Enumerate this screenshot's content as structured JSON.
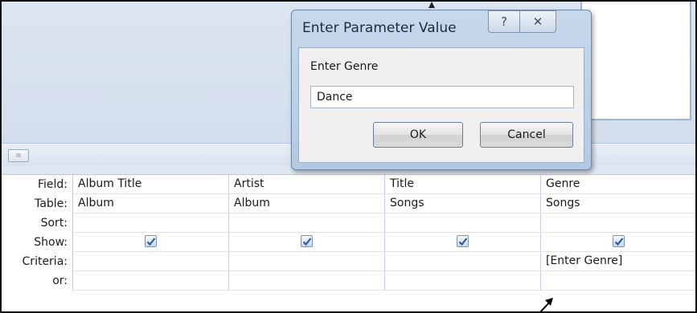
{
  "dialog": {
    "title": "Enter Parameter Value",
    "help_glyph": "?",
    "close_glyph": "✕",
    "prompt": "Enter Genre",
    "input_value": "Dance",
    "ok_label": "OK",
    "cancel_label": "Cancel"
  },
  "scrollbar": {
    "thumb_glyph": "III"
  },
  "grid": {
    "row_labels": [
      "Field:",
      "Table:",
      "Sort:",
      "Show:",
      "Criteria:",
      "or:"
    ],
    "columns": [
      {
        "field": "Album Title",
        "table": "Album",
        "sort": "",
        "show": true,
        "criteria": "",
        "or": ""
      },
      {
        "field": "Artist",
        "table": "Album",
        "sort": "",
        "show": true,
        "criteria": "",
        "or": ""
      },
      {
        "field": "Title",
        "table": "Songs",
        "sort": "",
        "show": true,
        "criteria": "",
        "or": ""
      },
      {
        "field": "Genre",
        "table": "Songs",
        "sort": "",
        "show": true,
        "criteria": "[Enter Genre]",
        "or": ""
      }
    ]
  },
  "colors": {
    "pane_background": "#d3deec",
    "dialog_frame": "#b4c9e2",
    "checkbox_tick": "#2a5aa8"
  }
}
